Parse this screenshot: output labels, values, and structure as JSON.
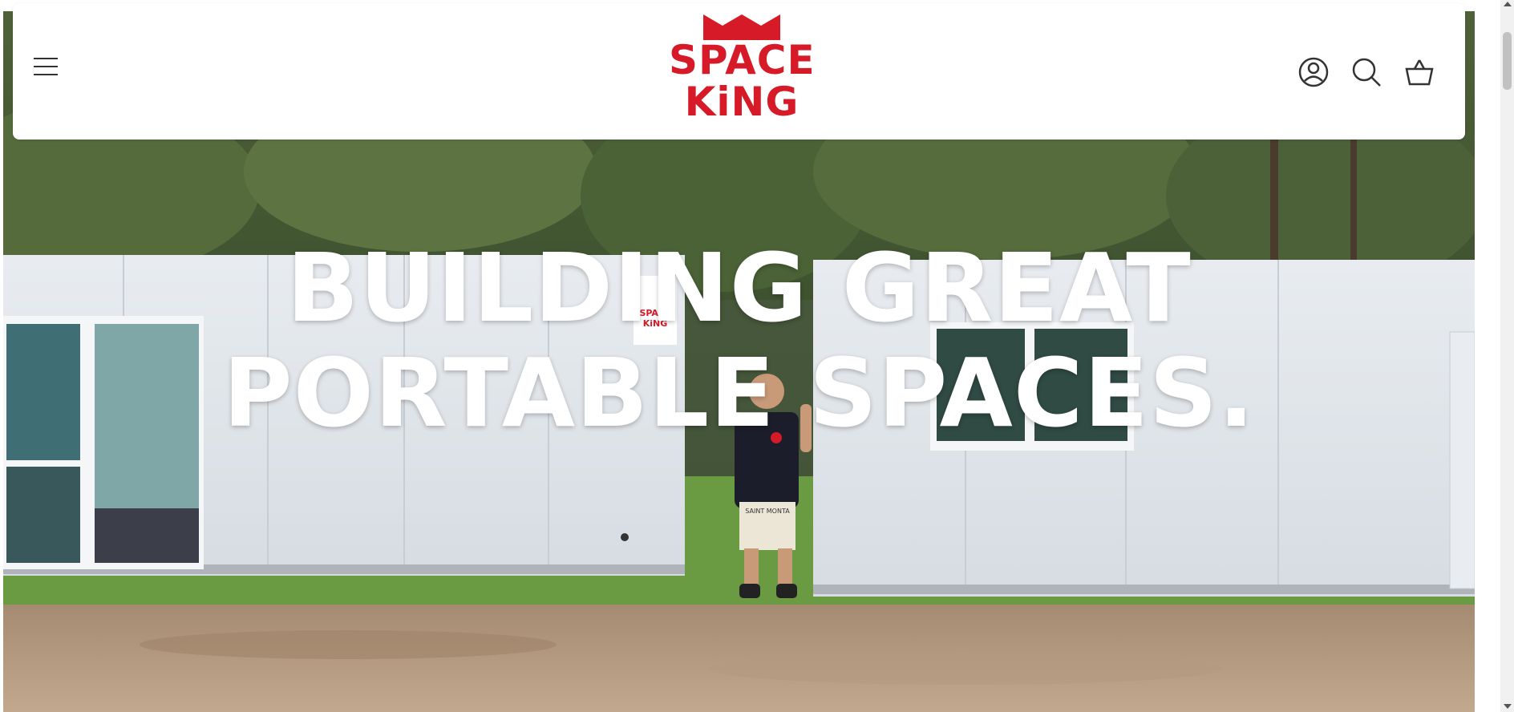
{
  "header": {
    "logo": {
      "line1": "SPACE",
      "line2": "KiNG"
    },
    "icons": {
      "menu": "hamburger-menu-icon",
      "account": "account-icon",
      "search": "search-icon",
      "cart": "basket-icon"
    }
  },
  "hero": {
    "headline_line1": "BUILDING GREAT",
    "headline_line2": "PORTABLE SPACES.",
    "sign": {
      "line1": "SPACE",
      "line2": "KiNG"
    },
    "shirt_text": "SAINT MONTA"
  },
  "colors": {
    "brand_red": "#d71a28",
    "header_bg": "#ffffff",
    "headline": "#ffffff"
  }
}
